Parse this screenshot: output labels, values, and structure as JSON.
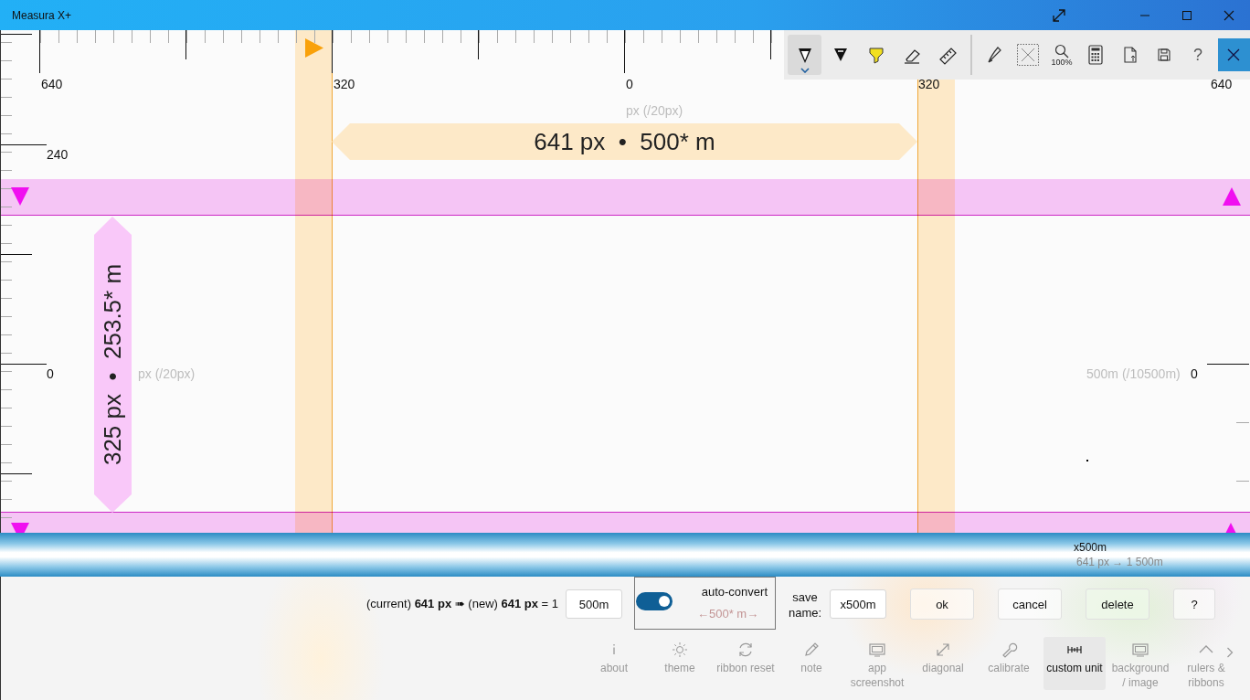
{
  "window": {
    "title": "Measura X+"
  },
  "toolbar": {
    "tools": [
      {
        "kind": "pen",
        "selected": true
      },
      {
        "kind": "marker",
        "selected": false
      },
      {
        "kind": "highlighter",
        "selected": false
      },
      {
        "kind": "eraser",
        "selected": false
      },
      {
        "kind": "ruler",
        "selected": false
      }
    ],
    "zoom_label": "100%",
    "help": "?"
  },
  "canvas": {
    "top_ruler_labels": [
      "640",
      "320",
      "0",
      "320",
      "640"
    ],
    "top_unit_caption": "px (/20px)",
    "left_ruler_labels": [
      "240",
      "0"
    ],
    "left_unit_caption": "px (/20px)",
    "right_ruler_labels": [
      "0"
    ],
    "right_unit_caption": "500m (/10500m)",
    "horizontal_measurement": "641 px  •  500* m",
    "vertical_measurement": "325 px  •  253.5* m"
  },
  "unit_strip": {
    "name": "x500m",
    "conversion": "641 px → 1 500m"
  },
  "converter": {
    "formula": "(current) **641 px** ➠ (new) **641 px** = 1",
    "unit_value": "500m",
    "auto_convert": {
      "label": "auto-convert",
      "on": true,
      "preview": "←500* m→"
    },
    "save_label": "save name:",
    "save_name": "x500m",
    "buttons": [
      {
        "kind": "ok",
        "label": "ok"
      },
      {
        "kind": "cancel",
        "label": "cancel"
      },
      {
        "kind": "delete",
        "label": "delete"
      },
      {
        "kind": "help",
        "label": "?"
      }
    ]
  },
  "ribbon": {
    "items": [
      {
        "kind": "about",
        "label": "about",
        "selected": false
      },
      {
        "kind": "theme",
        "label": "theme",
        "selected": false
      },
      {
        "kind": "reset",
        "label": "ribbon reset",
        "selected": false
      },
      {
        "kind": "note",
        "label": "note",
        "selected": false
      },
      {
        "kind": "screenshot",
        "label": "app screenshot",
        "selected": false
      },
      {
        "kind": "diagonal",
        "label": "diagonal",
        "selected": false
      },
      {
        "kind": "calibrate",
        "label": "calibrate",
        "selected": false
      },
      {
        "kind": "custom",
        "label": "custom unit",
        "selected": true
      },
      {
        "kind": "background",
        "label": "background / image",
        "selected": false
      },
      {
        "kind": "rulers",
        "label": "rulers & ribbons",
        "selected": false
      }
    ]
  }
}
